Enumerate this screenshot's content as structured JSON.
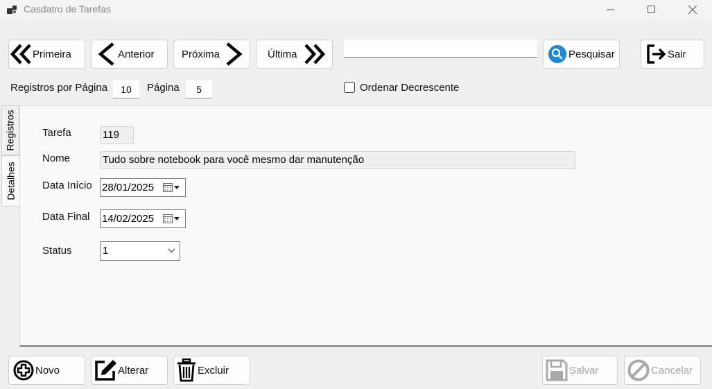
{
  "window": {
    "title": "Casdatro de Tarefas",
    "icon": "app-window-icon",
    "controls": [
      "minimize-icon",
      "maximize-icon",
      "close-icon"
    ]
  },
  "nav": {
    "first_label": "Primeira",
    "prev_label": "Anterior",
    "next_label": "Próxima",
    "last_label": "Última",
    "search_value": "",
    "search_label": "Pesquisar",
    "exit_label": "Sair"
  },
  "paging": {
    "per_page_label": "Registros por Página",
    "per_page_value": "10",
    "page_label": "Página",
    "page_value": "5",
    "order_desc_label": "Ordenar Decrescente",
    "order_desc_checked": false
  },
  "tabs": [
    {
      "label": "Registros",
      "active": false
    },
    {
      "label": "Detalhes",
      "active": true
    }
  ],
  "form": {
    "tarefa_label": "Tarefa",
    "tarefa_value": "119",
    "nome_label": "Nome",
    "nome_value": "Tudo sobre notebook para você mesmo dar manutenção",
    "data_inicio_label": "Data Início",
    "data_inicio_value": "28/01/2025",
    "data_final_label": "Data Final",
    "data_final_value": "14/02/2025",
    "status_label": "Status",
    "status_value": "1"
  },
  "actions": {
    "novo_label": "Novo",
    "alterar_label": "Alterar",
    "excluir_label": "Excluir",
    "salvar_label": "Salvar",
    "cancelar_label": "Cancelar"
  },
  "colors": {
    "accent_search": "#1e88d6",
    "disabled_text": "#a9a9a9",
    "panel_bg": "#f9f9f9"
  }
}
